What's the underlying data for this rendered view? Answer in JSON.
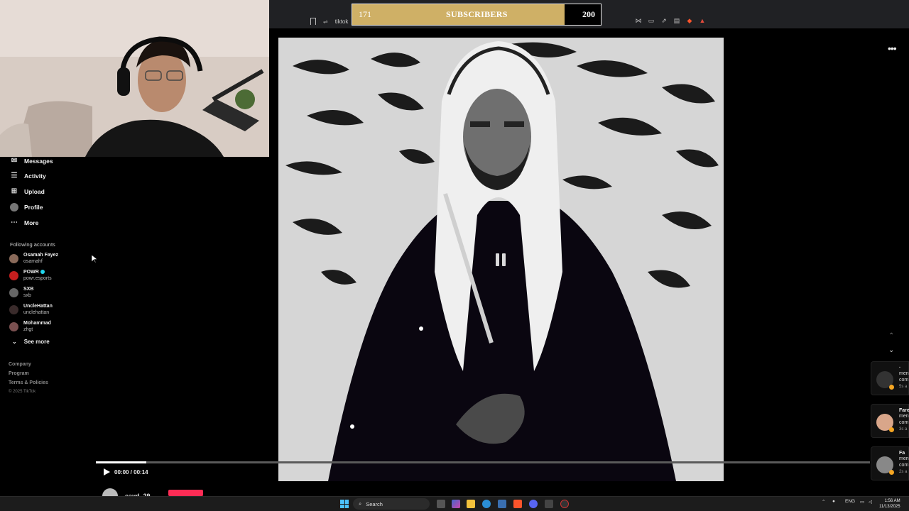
{
  "subscriber_goal": {
    "current": "171",
    "label": "SUBSCRIBERS",
    "target": "200",
    "progress_fraction": 0.855
  },
  "browser": {
    "url": "tiktok"
  },
  "sidebar": {
    "nav": [
      {
        "label": "Messages"
      },
      {
        "label": "Activity"
      },
      {
        "label": "Upload"
      },
      {
        "label": "Profile"
      },
      {
        "label": "More"
      }
    ],
    "following_title": "Following accounts",
    "accounts": [
      {
        "name": "Osamah Fayez",
        "username": "osamahf"
      },
      {
        "name": "POWR",
        "username": "powr.esports"
      },
      {
        "name": "SXB",
        "username": "sxb"
      },
      {
        "name": "UncleHattan",
        "username": "unclehattan"
      },
      {
        "name": "Mohammad",
        "username": "zhgt"
      }
    ],
    "see_more": "See more",
    "footer": [
      "Company",
      "Program",
      "Terms & Policies"
    ],
    "copyright": "© 2025 TikTok"
  },
  "player": {
    "time": "00:00 / 00:14",
    "progress_fraction": 0.065,
    "author": "eayd_29"
  },
  "notifications": [
    {
      "line1": "·",
      "line2": "men",
      "line3": "com",
      "age": "5s a"
    },
    {
      "line1": "Fare",
      "line2": "men",
      "line3": "com",
      "age": "3s a"
    },
    {
      "line1": "Fa",
      "line2": "men",
      "line3": "com",
      "age": "2s a"
    }
  ],
  "taskbar": {
    "search": "Search",
    "lang": "ENG",
    "time": "1:56 AM",
    "date": "11/13/2025"
  },
  "colors": {
    "goal_fill": "#cfb066",
    "tiktok_red": "#fe2c55",
    "verified": "#20d5ec"
  }
}
